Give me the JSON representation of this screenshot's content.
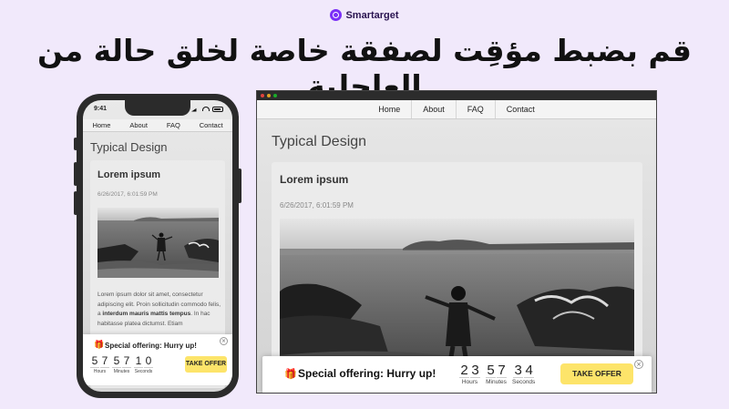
{
  "brand": {
    "name": "Smartarget",
    "logo_icon": "target-icon",
    "color": "#7b2ff7"
  },
  "headline": "قم بضبط مؤقِت لصفقة خاصة لخلق حالة من العاجلية",
  "phone": {
    "time": "9:41",
    "nav": [
      "Home",
      "About",
      "FAQ",
      "Contact"
    ],
    "page_title": "Typical Design",
    "card": {
      "title": "Lorem ipsum",
      "date": "6/26/2017, 6:01:59 PM",
      "body_1": "Lorem ipsum dolor sit amet, consectetur adipiscing elit. Proin sollicitudin commodo felis, a ",
      "body_bold": "interdum mauris mattis tempus",
      "body_2": ". In hac habitasse platea dictumst. Etiam"
    },
    "popup": {
      "gift_icon": "gift-icon",
      "title": "Special offering: Hurry up!",
      "hours": [
        "5",
        "7"
      ],
      "minutes": [
        "5",
        "7"
      ],
      "seconds": [
        "1",
        "0"
      ],
      "hours_label": "Hours",
      "minutes_label": "Minutes",
      "seconds_label": "Seconds",
      "cta": "TAKE OFFER",
      "close": "×"
    }
  },
  "desktop": {
    "nav": [
      "Home",
      "About",
      "FAQ",
      "Contact"
    ],
    "page_title": "Typical Design",
    "card": {
      "title": "Lorem ipsum",
      "date": "6/26/2017, 6:01:59 PM"
    },
    "popup": {
      "gift": "🎁",
      "title": "Special offering: Hurry up!",
      "hours": [
        "2",
        "3"
      ],
      "minutes": [
        "5",
        "7"
      ],
      "seconds": [
        "3",
        "4"
      ],
      "hours_label": "Hours",
      "minutes_label": "Minutes",
      "seconds_label": "Seconds",
      "cta": "TAKE OFFER",
      "close": "×"
    },
    "window_dots": [
      "#e0443e",
      "#dea123",
      "#1aab29"
    ]
  },
  "colors": {
    "background": "#f1e9fb",
    "cta": "#fde46a"
  }
}
